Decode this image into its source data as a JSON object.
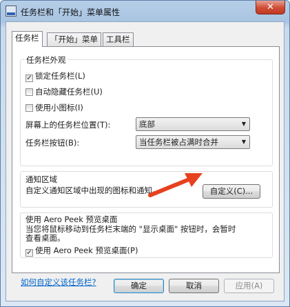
{
  "window": {
    "title": "任务栏和「开始」菜单属性",
    "close_label": "✕"
  },
  "tabs": [
    {
      "label": "任务栏",
      "active": true
    },
    {
      "label": "「开始」菜单",
      "active": false
    },
    {
      "label": "工具栏",
      "active": false
    }
  ],
  "appearance": {
    "title": "任务栏外观",
    "lock_taskbar": {
      "label": "锁定任务栏(L)",
      "checked": true
    },
    "auto_hide": {
      "label": "自动隐藏任务栏(U)",
      "checked": false
    },
    "small_icons": {
      "label": "使用小图标(I)",
      "checked": false
    },
    "position_label": "屏幕上的任务栏位置(T):",
    "position_value": "底部",
    "buttons_label": "任务栏按钮(B):",
    "buttons_value": "当任务栏被占满时合并"
  },
  "notification": {
    "title": "通知区域",
    "description": "自定义通知区域中出现的图标和通知。",
    "customize_button": "自定义(C)..."
  },
  "aero_peek": {
    "title": "使用 Aero Peek 预览桌面",
    "description_line1": "当您将鼠标移动到任务栏末端的 \"显示桌面\" 按钮时，会暂时",
    "description_line2": "查看桌面。",
    "checkbox": {
      "label": "使用 Aero Peek 预览桌面(P)",
      "checked": true
    }
  },
  "help_link": "如何自定义该任务栏?",
  "footer": {
    "ok": "确定",
    "cancel": "取消",
    "apply": "应用(A)"
  },
  "colors": {
    "annotation_arrow": "#e8411f",
    "link": "#0066cc",
    "title_bar": "#a9c4e2"
  }
}
